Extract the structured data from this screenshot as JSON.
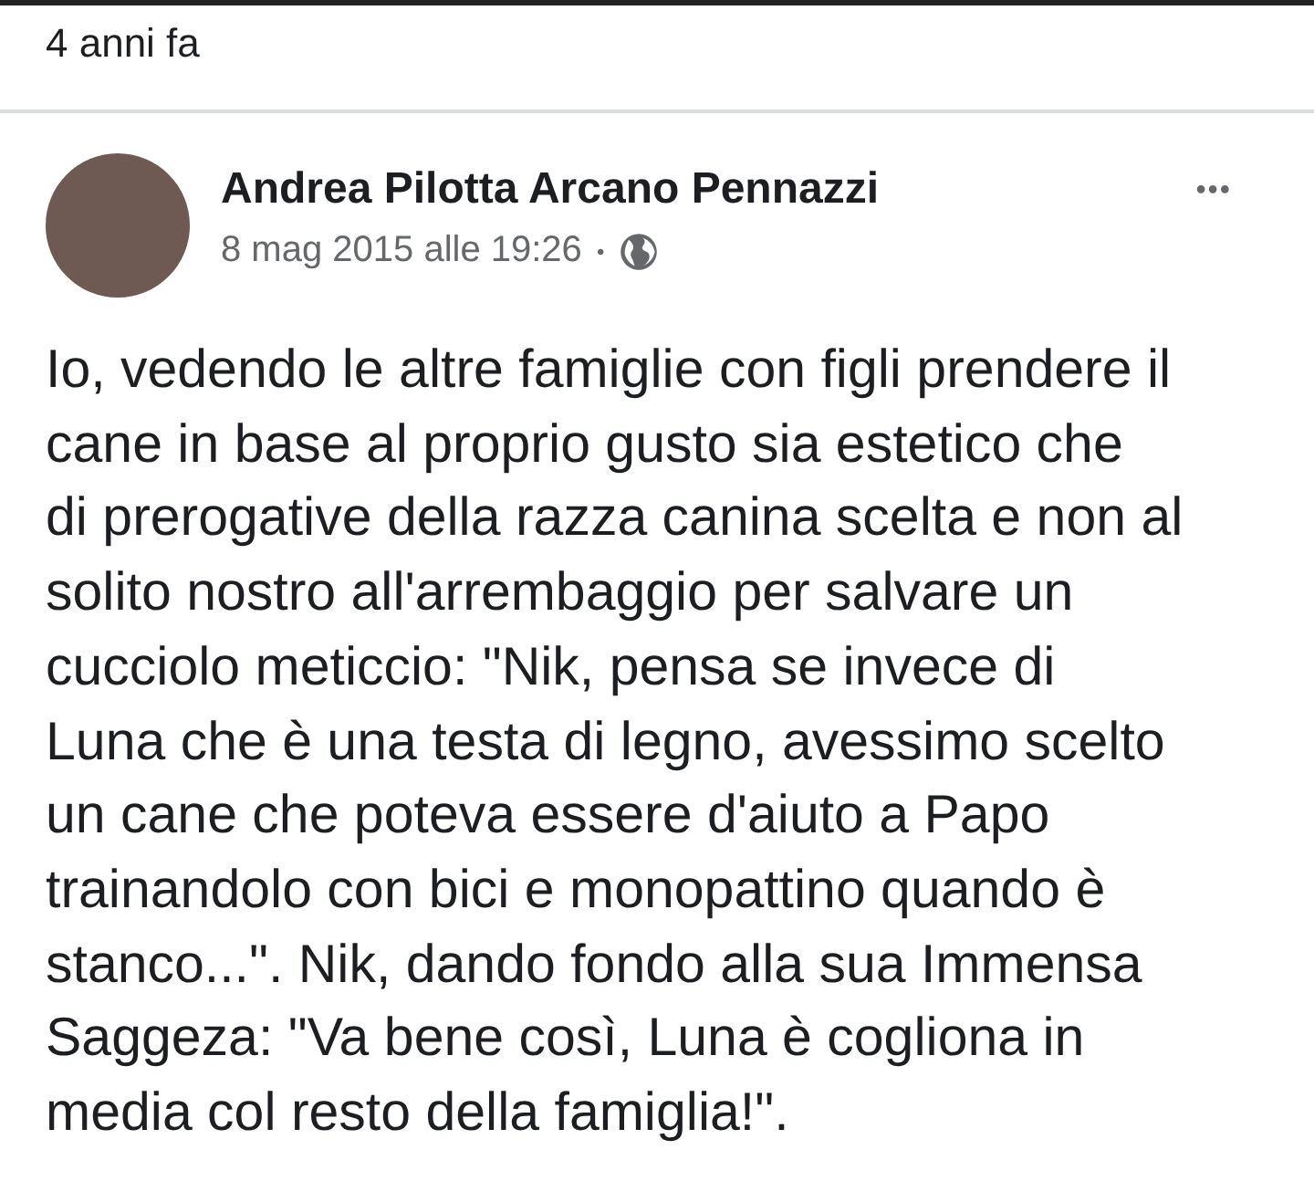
{
  "header": {
    "time_ago": "4 anni fa"
  },
  "post": {
    "author": "Andrea Pilotta Arcano Pennazzi",
    "date": "8 mag 2015 alle 19:26",
    "separator": "•",
    "more": "•••",
    "text": "Io, vedendo le altre famiglie con figli prendere il\ncane in base al proprio gusto sia estetico che\ndi prerogative della razza canina scelta e non al\nsolito nostro all'arrembaggio per salvare un\ncucciolo meticcio: \"Nik, pensa se invece di\nLuna che è una testa di legno, avessimo scelto\nun cane che poteva essere d'aiuto a Papo\ntrainandolo con bici e monopattino quando è\nstanco...\". Nik, dando fondo alla sua Immensa\nSaggeza: \"Va bene così, Luna è cogliona in\nmedia col resto della famiglia!\"."
  }
}
